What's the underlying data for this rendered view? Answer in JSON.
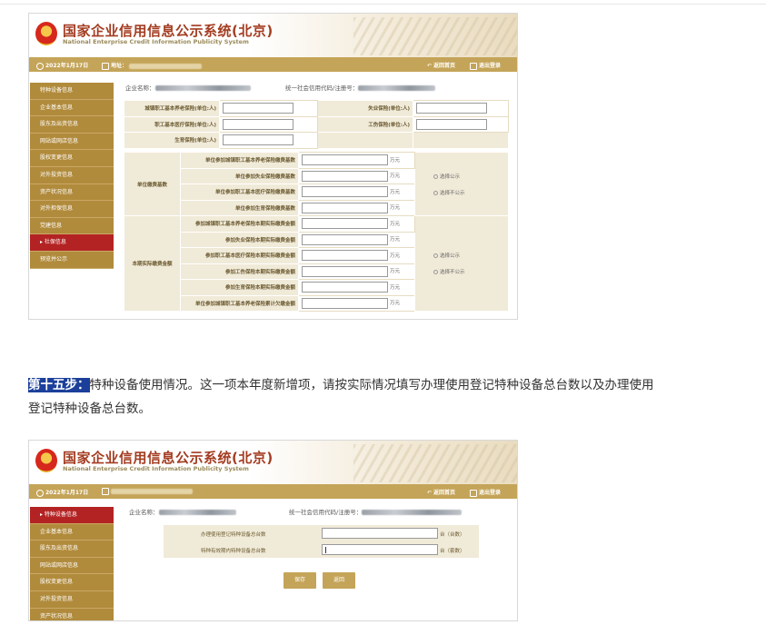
{
  "shot1": {
    "title": "国家企业信用信息公示系统",
    "title_region": "(北京)",
    "subtitle": "National Enterprise Credit Information Publicity System",
    "date": "2022年1月17日",
    "addr_label": "地址：",
    "back_home": "返回首页",
    "logout": "退出登录",
    "sidebar": [
      "特种设备信息",
      "企业基本信息",
      "股东及出资信息",
      "网站或网店信息",
      "股权变更信息",
      "对外投资信息",
      "资产状况信息",
      "对外担保信息",
      "党建信息",
      "社保信息",
      "预览并公示"
    ],
    "active_sidebar": "社保信息",
    "company_label": "企业名称：",
    "credit_label": "统一社会信用代码/注册号：",
    "insurance_rows": [
      {
        "l": "城镇职工基本养老保险(单位:人)",
        "r": "失业保险(单位:人)"
      },
      {
        "l": "职工基本医疗保险(单位:人)",
        "r": "工伤保险(单位:人)"
      },
      {
        "l": "生育保险(单位:人)",
        "r": ""
      }
    ],
    "group1_label": "单位缴费基数",
    "group1_items": [
      "单位参加城镇职工基本养老保险缴费基数",
      "单位参加失业保险缴费基数",
      "单位参加职工基本医疗保险缴费基数",
      "单位参加生育保险缴费基数"
    ],
    "group2_label": "本期实际缴费金额",
    "group2_items": [
      "参加城镇职工基本养老保险本期实际缴费金额",
      "参加失业保险本期实际缴费金额",
      "参加职工基本医疗保险本期实际缴费金额",
      "参加工伤保险本期实际缴费金额",
      "参加生育保险本期实际缴费金额",
      "单位参加城镇职工基本养老保险累计欠缴金额"
    ],
    "unit": "万元",
    "radio_public": "选择公示",
    "radio_private": "选择不公示"
  },
  "step": {
    "tag": "第十五步：",
    "text": "特种设备使用情况。这一项本年度新增项，请按实际情况填写办理使用登记特种设备总台数以及办理使用登记特种设备总台数。"
  },
  "shot2": {
    "title": "国家企业信用信息公示系统",
    "title_region": "(北京)",
    "subtitle": "National Enterprise Credit Information Publicity System",
    "date": "2022年1月17日",
    "back_home": "返回首页",
    "logout": "退出登录",
    "sidebar": [
      "特种设备信息",
      "企业基本信息",
      "股东及出资信息",
      "网站或网店信息",
      "股权变更信息",
      "对外投资信息",
      "资产状况信息"
    ],
    "active_sidebar": "特种设备信息",
    "company_label": "企业名称：",
    "credit_label": "统一社会信用代码/注册号：",
    "row1_label": "办理使用登记特种设备总台数",
    "row1_unit": "台（台数）",
    "row2_label": "特种有效期内特种设备总台数",
    "row2_unit": "台（套数）",
    "save": "保存",
    "back": "返回"
  }
}
